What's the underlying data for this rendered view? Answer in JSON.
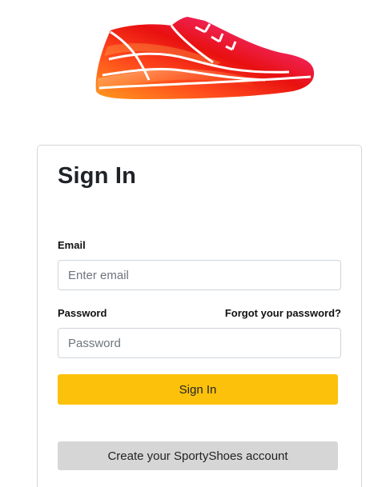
{
  "brand": {
    "logo_icon": "sneaker-logo-icon"
  },
  "signin": {
    "title": "Sign In",
    "email_label": "Email",
    "email_placeholder": "Enter email",
    "email_value": "",
    "password_label": "Password",
    "password_placeholder": "Password",
    "password_value": "",
    "forgot_link": "Forgot your password?",
    "submit_label": "Sign In",
    "create_account_label": "Create your SportyShoes account"
  },
  "colors": {
    "primary_button": "#fcc10b",
    "secondary_button": "#d6d6d6",
    "card_border": "#d3d6d9"
  }
}
